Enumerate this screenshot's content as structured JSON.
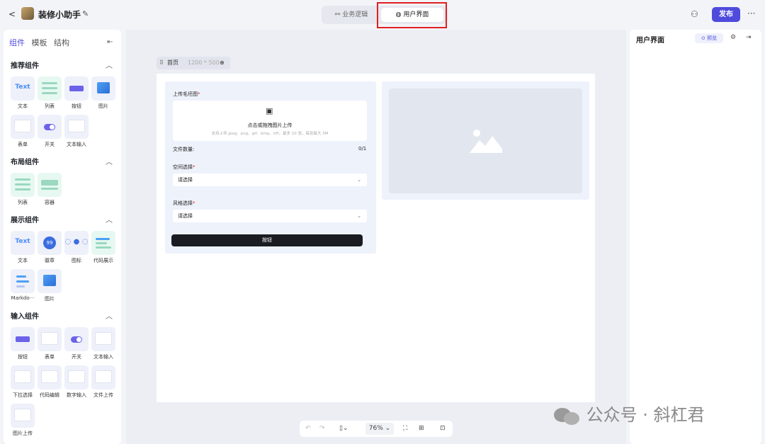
{
  "header": {
    "back": "<",
    "app_title": "装修小助手",
    "edit_icon": "✎",
    "tabs": [
      {
        "label": "业务逻辑",
        "icon": "flow-icon"
      },
      {
        "label": "用户界面",
        "icon": "palette-icon",
        "active": true
      }
    ],
    "publish_label": "发布",
    "more": "···"
  },
  "left_panel": {
    "tabs": [
      "组件",
      "模板",
      "结构"
    ],
    "active_tab": "组件",
    "sections": [
      {
        "title": "推荐组件",
        "items": [
          "文本",
          "列表",
          "按钮",
          "图片",
          "表单",
          "开关",
          "文本输入"
        ]
      },
      {
        "title": "布局组件",
        "items": [
          "列表",
          "容器"
        ]
      },
      {
        "title": "展示组件",
        "items": [
          "文本",
          "徽章",
          "图标",
          "代码展示",
          "Markdo···",
          "图片"
        ]
      },
      {
        "title": "输入组件",
        "items": [
          "按钮",
          "表单",
          "开关",
          "文本输入",
          "下拉选择",
          "代码编辑",
          "数字输入",
          "文件上传",
          "图片上传"
        ]
      }
    ],
    "thumb_text": "Text",
    "badge_text": "99"
  },
  "canvas": {
    "page_name": "首页",
    "page_size": "1200 * 500",
    "form": {
      "upload_label": "上传毛坯图",
      "upload_title": "点击或拖拽图片上传",
      "upload_hint": "支持上传 jpeg、png、gif、bmp、tiff，最多 10 张，每张最大 5M",
      "count_label": "文件数量:",
      "count_value": "0/1",
      "space_label": "空间选择",
      "space_placeholder": "请选择",
      "style_label": "风格选择",
      "style_placeholder": "请选择",
      "button_label": "按钮"
    }
  },
  "bottom_bar": {
    "zoom": "76%"
  },
  "right_panel": {
    "title": "用户界面",
    "preview_label": "预览"
  },
  "watermark": "公众号 · 斜杠君",
  "colors": {
    "accent": "#4e4bdc",
    "highlight": "#e02020"
  }
}
